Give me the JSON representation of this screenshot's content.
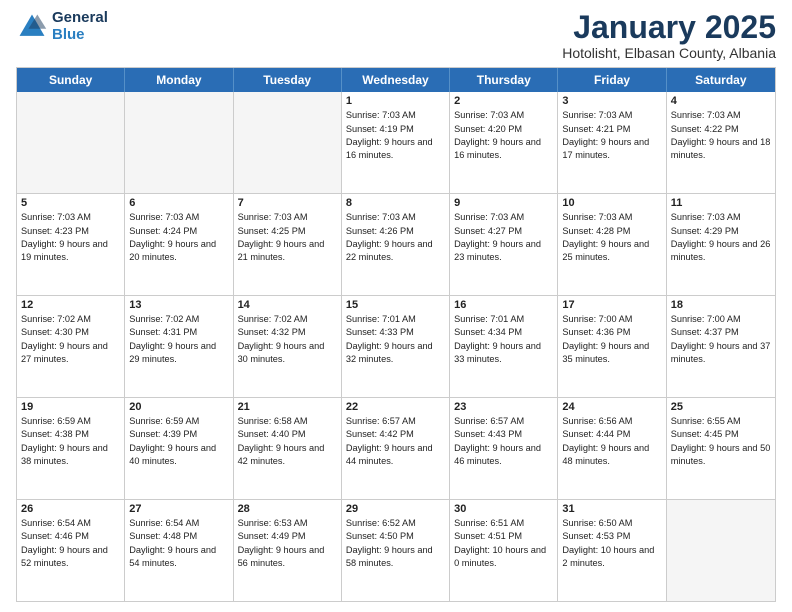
{
  "logo": {
    "general": "General",
    "blue": "Blue"
  },
  "title": "January 2025",
  "location": "Hotolisht, Elbasan County, Albania",
  "weekdays": [
    "Sunday",
    "Monday",
    "Tuesday",
    "Wednesday",
    "Thursday",
    "Friday",
    "Saturday"
  ],
  "weeks": [
    [
      {
        "day": "",
        "empty": true
      },
      {
        "day": "",
        "empty": true
      },
      {
        "day": "",
        "empty": true
      },
      {
        "day": "1",
        "sunrise": "7:03 AM",
        "sunset": "4:19 PM",
        "daylight": "9 hours and 16 minutes."
      },
      {
        "day": "2",
        "sunrise": "7:03 AM",
        "sunset": "4:20 PM",
        "daylight": "9 hours and 16 minutes."
      },
      {
        "day": "3",
        "sunrise": "7:03 AM",
        "sunset": "4:21 PM",
        "daylight": "9 hours and 17 minutes."
      },
      {
        "day": "4",
        "sunrise": "7:03 AM",
        "sunset": "4:22 PM",
        "daylight": "9 hours and 18 minutes."
      }
    ],
    [
      {
        "day": "5",
        "sunrise": "7:03 AM",
        "sunset": "4:23 PM",
        "daylight": "9 hours and 19 minutes."
      },
      {
        "day": "6",
        "sunrise": "7:03 AM",
        "sunset": "4:24 PM",
        "daylight": "9 hours and 20 minutes."
      },
      {
        "day": "7",
        "sunrise": "7:03 AM",
        "sunset": "4:25 PM",
        "daylight": "9 hours and 21 minutes."
      },
      {
        "day": "8",
        "sunrise": "7:03 AM",
        "sunset": "4:26 PM",
        "daylight": "9 hours and 22 minutes."
      },
      {
        "day": "9",
        "sunrise": "7:03 AM",
        "sunset": "4:27 PM",
        "daylight": "9 hours and 23 minutes."
      },
      {
        "day": "10",
        "sunrise": "7:03 AM",
        "sunset": "4:28 PM",
        "daylight": "9 hours and 25 minutes."
      },
      {
        "day": "11",
        "sunrise": "7:03 AM",
        "sunset": "4:29 PM",
        "daylight": "9 hours and 26 minutes."
      }
    ],
    [
      {
        "day": "12",
        "sunrise": "7:02 AM",
        "sunset": "4:30 PM",
        "daylight": "9 hours and 27 minutes."
      },
      {
        "day": "13",
        "sunrise": "7:02 AM",
        "sunset": "4:31 PM",
        "daylight": "9 hours and 29 minutes."
      },
      {
        "day": "14",
        "sunrise": "7:02 AM",
        "sunset": "4:32 PM",
        "daylight": "9 hours and 30 minutes."
      },
      {
        "day": "15",
        "sunrise": "7:01 AM",
        "sunset": "4:33 PM",
        "daylight": "9 hours and 32 minutes."
      },
      {
        "day": "16",
        "sunrise": "7:01 AM",
        "sunset": "4:34 PM",
        "daylight": "9 hours and 33 minutes."
      },
      {
        "day": "17",
        "sunrise": "7:00 AM",
        "sunset": "4:36 PM",
        "daylight": "9 hours and 35 minutes."
      },
      {
        "day": "18",
        "sunrise": "7:00 AM",
        "sunset": "4:37 PM",
        "daylight": "9 hours and 37 minutes."
      }
    ],
    [
      {
        "day": "19",
        "sunrise": "6:59 AM",
        "sunset": "4:38 PM",
        "daylight": "9 hours and 38 minutes."
      },
      {
        "day": "20",
        "sunrise": "6:59 AM",
        "sunset": "4:39 PM",
        "daylight": "9 hours and 40 minutes."
      },
      {
        "day": "21",
        "sunrise": "6:58 AM",
        "sunset": "4:40 PM",
        "daylight": "9 hours and 42 minutes."
      },
      {
        "day": "22",
        "sunrise": "6:57 AM",
        "sunset": "4:42 PM",
        "daylight": "9 hours and 44 minutes."
      },
      {
        "day": "23",
        "sunrise": "6:57 AM",
        "sunset": "4:43 PM",
        "daylight": "9 hours and 46 minutes."
      },
      {
        "day": "24",
        "sunrise": "6:56 AM",
        "sunset": "4:44 PM",
        "daylight": "9 hours and 48 minutes."
      },
      {
        "day": "25",
        "sunrise": "6:55 AM",
        "sunset": "4:45 PM",
        "daylight": "9 hours and 50 minutes."
      }
    ],
    [
      {
        "day": "26",
        "sunrise": "6:54 AM",
        "sunset": "4:46 PM",
        "daylight": "9 hours and 52 minutes."
      },
      {
        "day": "27",
        "sunrise": "6:54 AM",
        "sunset": "4:48 PM",
        "daylight": "9 hours and 54 minutes."
      },
      {
        "day": "28",
        "sunrise": "6:53 AM",
        "sunset": "4:49 PM",
        "daylight": "9 hours and 56 minutes."
      },
      {
        "day": "29",
        "sunrise": "6:52 AM",
        "sunset": "4:50 PM",
        "daylight": "9 hours and 58 minutes."
      },
      {
        "day": "30",
        "sunrise": "6:51 AM",
        "sunset": "4:51 PM",
        "daylight": "10 hours and 0 minutes."
      },
      {
        "day": "31",
        "sunrise": "6:50 AM",
        "sunset": "4:53 PM",
        "daylight": "10 hours and 2 minutes."
      },
      {
        "day": "",
        "empty": true
      }
    ]
  ]
}
